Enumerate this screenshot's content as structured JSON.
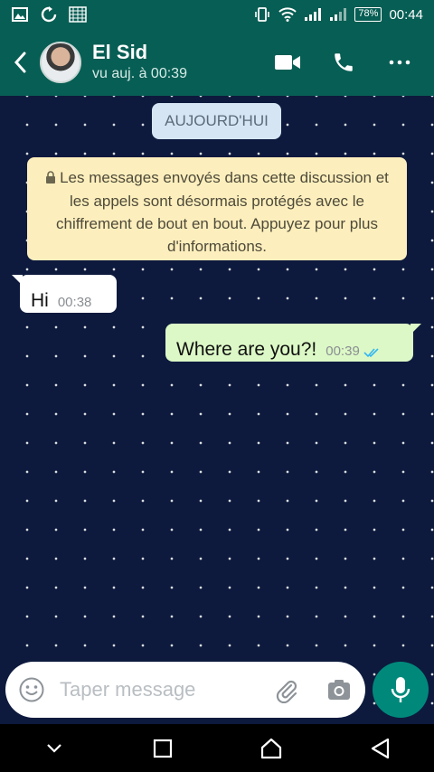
{
  "status_bar": {
    "battery": "78%",
    "time": "00:44",
    "icons": [
      "image-icon",
      "sync-icon",
      "grid-icon",
      "vibrate-icon",
      "wifi-icon",
      "signal-icon",
      "signal-icon-2",
      "battery-icon"
    ]
  },
  "header": {
    "contact_name": "El Sid",
    "last_seen": "vu auj. à 00:39",
    "icons": [
      "back-arrow-icon",
      "video-call-icon",
      "phone-icon",
      "more-dots-icon"
    ]
  },
  "chat": {
    "date_label": "AUJOURD'HUI",
    "encryption_notice": "Les messages envoyés dans cette discussion et les appels sont désormais protégés avec le chiffrement de bout en bout. Appuyez pour plus d'informations.",
    "messages": [
      {
        "direction": "in",
        "text": "Hi",
        "time": "00:38"
      },
      {
        "direction": "out",
        "text": "Where are you?!",
        "time": "00:39",
        "status": "read"
      }
    ]
  },
  "composer": {
    "placeholder": "Taper message",
    "value": "",
    "icons": [
      "emoji-icon",
      "paperclip-icon",
      "camera-icon",
      "mic-icon"
    ]
  },
  "nav_bar": {
    "icons": [
      "chevron-down-icon",
      "recents-square-icon",
      "home-icon",
      "back-triangle-icon"
    ]
  },
  "colors": {
    "header": "#075e54",
    "chat_background": "#0d1a3d",
    "outgoing_bubble": "#dcf8c6",
    "incoming_bubble": "#ffffff",
    "notice": "#fdefbd",
    "mic_button": "#00897b",
    "read_ticks": "#34b7f1"
  }
}
